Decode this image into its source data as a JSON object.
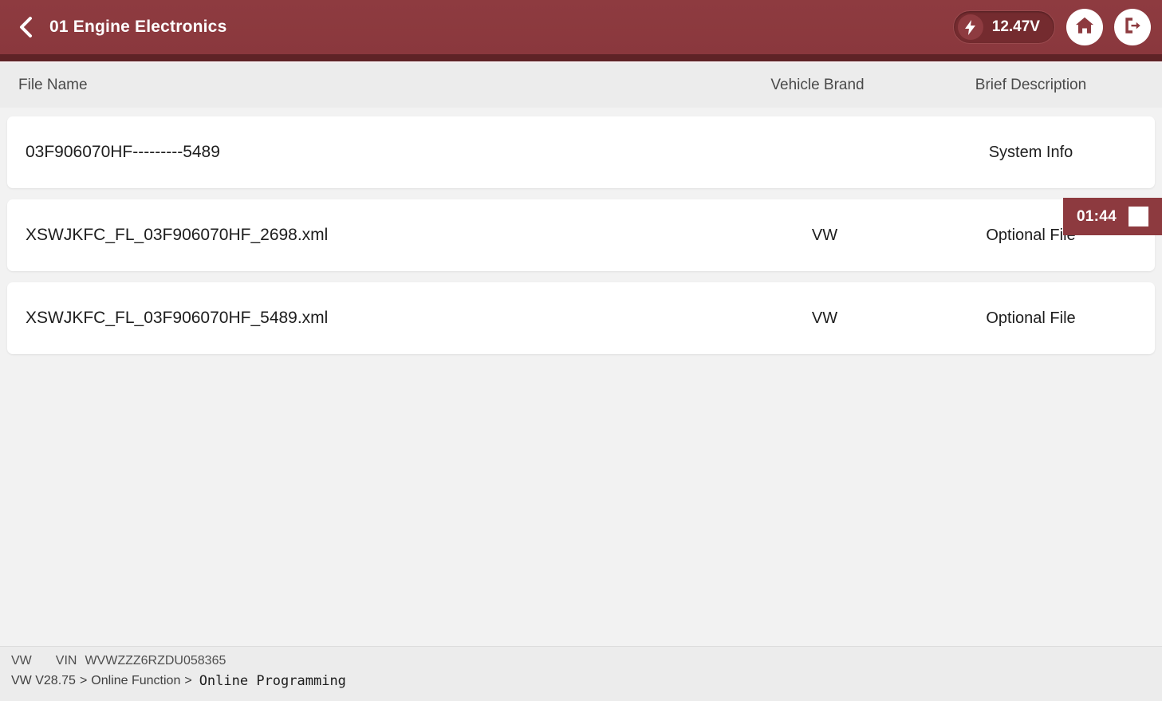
{
  "header": {
    "back_icon": "chevron-left-icon",
    "title": "01 Engine Electronics",
    "voltage": "12.47V",
    "bolt_icon": "lightning-bolt-icon",
    "home_icon": "home-icon",
    "exit_icon": "exit-icon",
    "bar_color": "#8d3a3f",
    "accent_dark": "#5e2326"
  },
  "timer": {
    "value": "01:44",
    "stop_icon": "stop-square-icon"
  },
  "table": {
    "columns": [
      {
        "key": "file_name",
        "label": "File Name"
      },
      {
        "key": "vehicle_brand",
        "label": "Vehicle Brand"
      },
      {
        "key": "brief_description",
        "label": "Brief Description"
      }
    ],
    "rows": [
      {
        "file_name": "03F906070HF---------5489",
        "vehicle_brand": "",
        "brief_description": "System Info"
      },
      {
        "file_name": "XSWJKFC_FL_03F906070HF_2698.xml",
        "vehicle_brand": "VW",
        "brief_description": "Optional File"
      },
      {
        "file_name": "XSWJKFC_FL_03F906070HF_5489.xml",
        "vehicle_brand": "VW",
        "brief_description": "Optional File"
      }
    ]
  },
  "footer": {
    "brand": "VW",
    "vin_label": "VIN",
    "vin_value": "WVWZZZ6RZDU058365",
    "breadcrumb": {
      "root": "VW V28.75",
      "sep1": ">",
      "level1": "Online Function",
      "sep2": ">",
      "current": "Online Programming"
    }
  }
}
